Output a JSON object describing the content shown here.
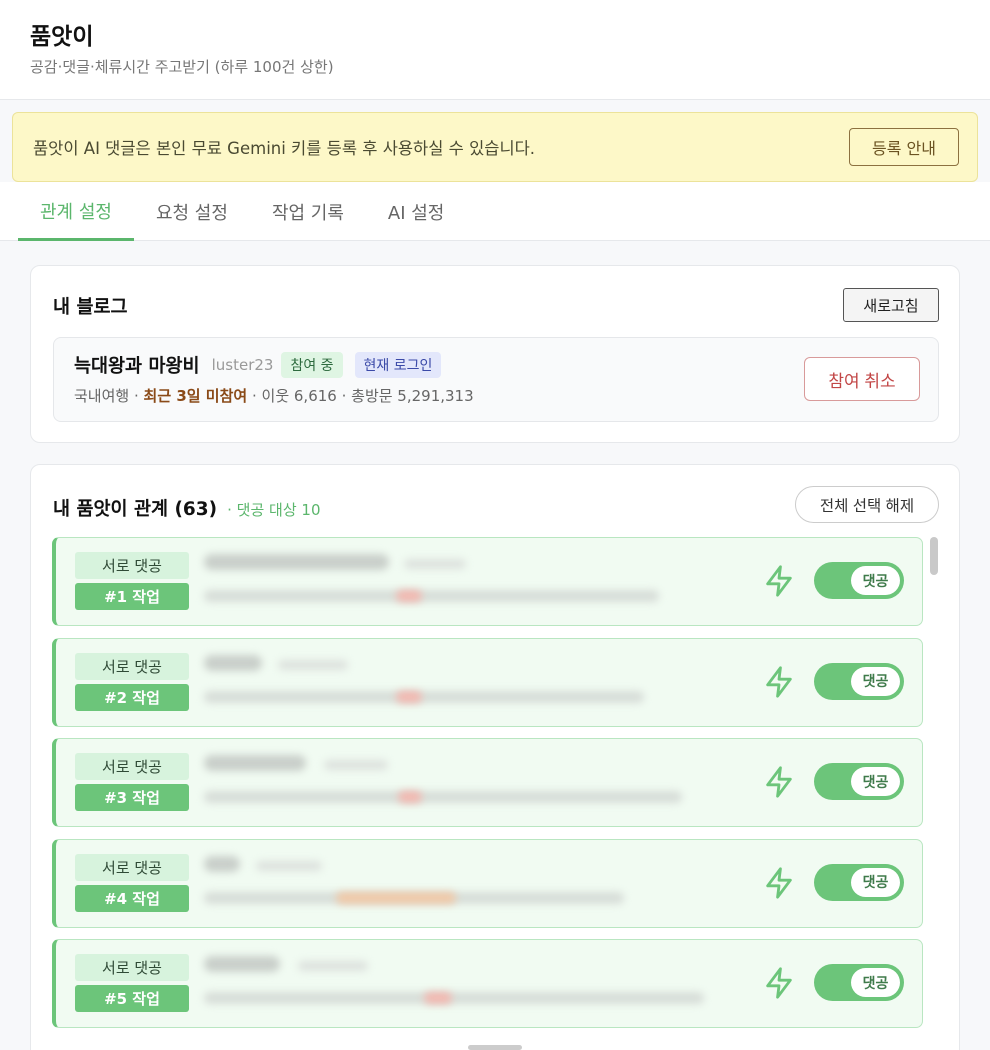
{
  "header": {
    "title": "품앗이",
    "subtitle": "공감·댓글·체류시간 주고받기 (하루 100건 상한)"
  },
  "notice": {
    "message": "품앗이 AI 댓글은 본인 무료 Gemini 키를 등록 후 사용하실 수 있습니다.",
    "button_label": "등록 안내"
  },
  "tabs": [
    {
      "label": "관계 설정",
      "active": true
    },
    {
      "label": "요청 설정",
      "active": false
    },
    {
      "label": "작업 기록",
      "active": false
    },
    {
      "label": "AI 설정",
      "active": false
    }
  ],
  "my_blog": {
    "title": "내 블로그",
    "refresh_label": "새로고침",
    "name": "늑대왕과 마왕비",
    "id": "luster23",
    "status_chip": "참여 중",
    "login_chip": "현재 로그인",
    "category": "국내여행",
    "sep1": " · ",
    "inactive_note": "최근 3일 미참여",
    "sep2": " · ",
    "neighbors": "이웃 6,616",
    "sep3": " · ",
    "visits": "총방문 5,291,313",
    "leave_label": "참여 취소"
  },
  "relations": {
    "title": "내 품앗이 관계",
    "count": "(63)",
    "target_note": "· 댓공 대상 10",
    "deselect_label": "전체 선택 해제",
    "rows": [
      {
        "mutual": "서로 댓공",
        "job": "#1 작업",
        "toggle": "댓공"
      },
      {
        "mutual": "서로 댓공",
        "job": "#2 작업",
        "toggle": "댓공"
      },
      {
        "mutual": "서로 댓공",
        "job": "#3 작업",
        "toggle": "댓공"
      },
      {
        "mutual": "서로 댓공",
        "job": "#4 작업",
        "toggle": "댓공"
      },
      {
        "mutual": "서로 댓공",
        "job": "#5 작업",
        "toggle": "댓공"
      }
    ]
  },
  "colors": {
    "accent_green": "#6cc57a",
    "notice_bg": "#fdf8c8",
    "danger": "#c24646"
  }
}
